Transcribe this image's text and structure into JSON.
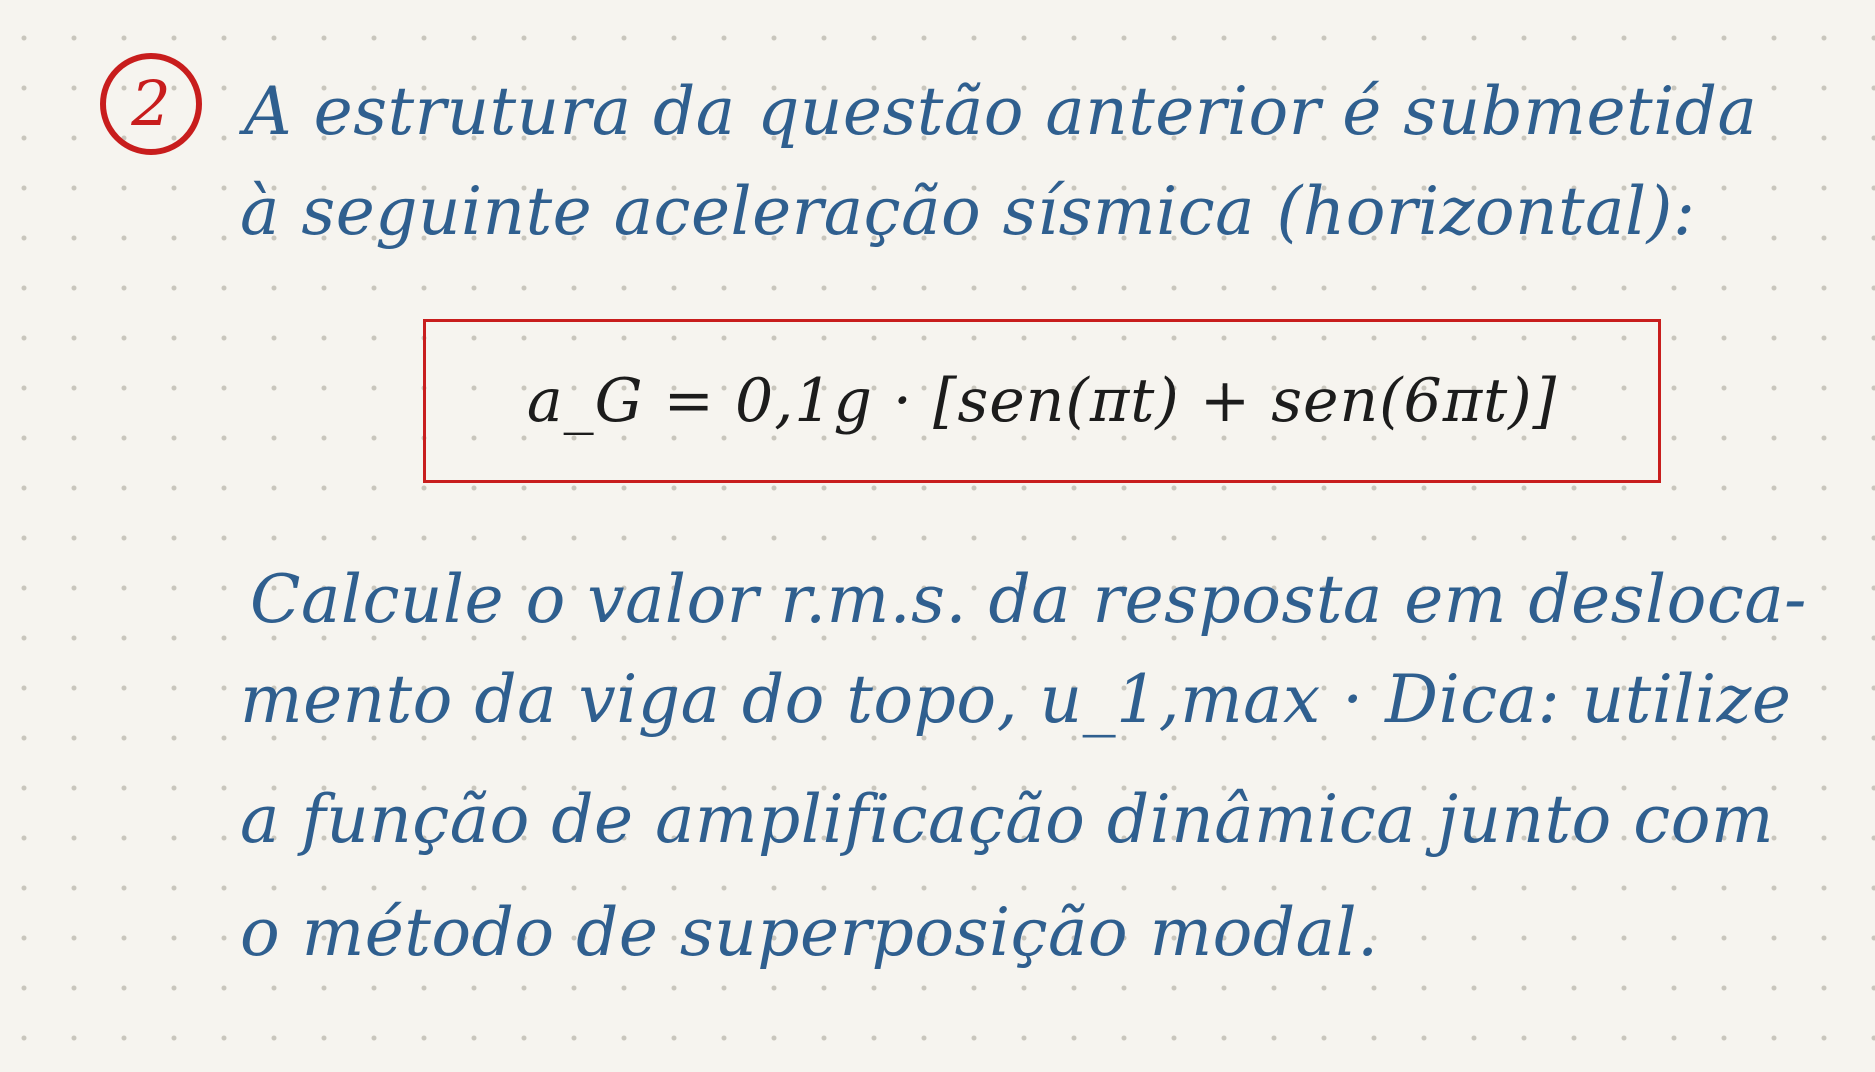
{
  "question": {
    "number": "2",
    "intro_line_1": "A estrutura da questão anterior é submetida",
    "intro_line_2": "à seguinte aceleração sísmica (horizontal):"
  },
  "formula": {
    "text": "a_G = 0,1g · [sen(πt) + sen(6πt)]"
  },
  "task": {
    "line_1": "Calcule o valor r.m.s. da resposta em desloca-",
    "line_2": "mento da viga do topo, u_1,max · Dica: utilize",
    "line_3": "a função de amplificação dinâmica junto com",
    "line_4": "o método de superposição modal."
  },
  "colors": {
    "ink": "#2f5f8f",
    "accent": "#c81d1d",
    "formula_ink": "#1c1c1c",
    "paper": "#f6f4ef"
  }
}
